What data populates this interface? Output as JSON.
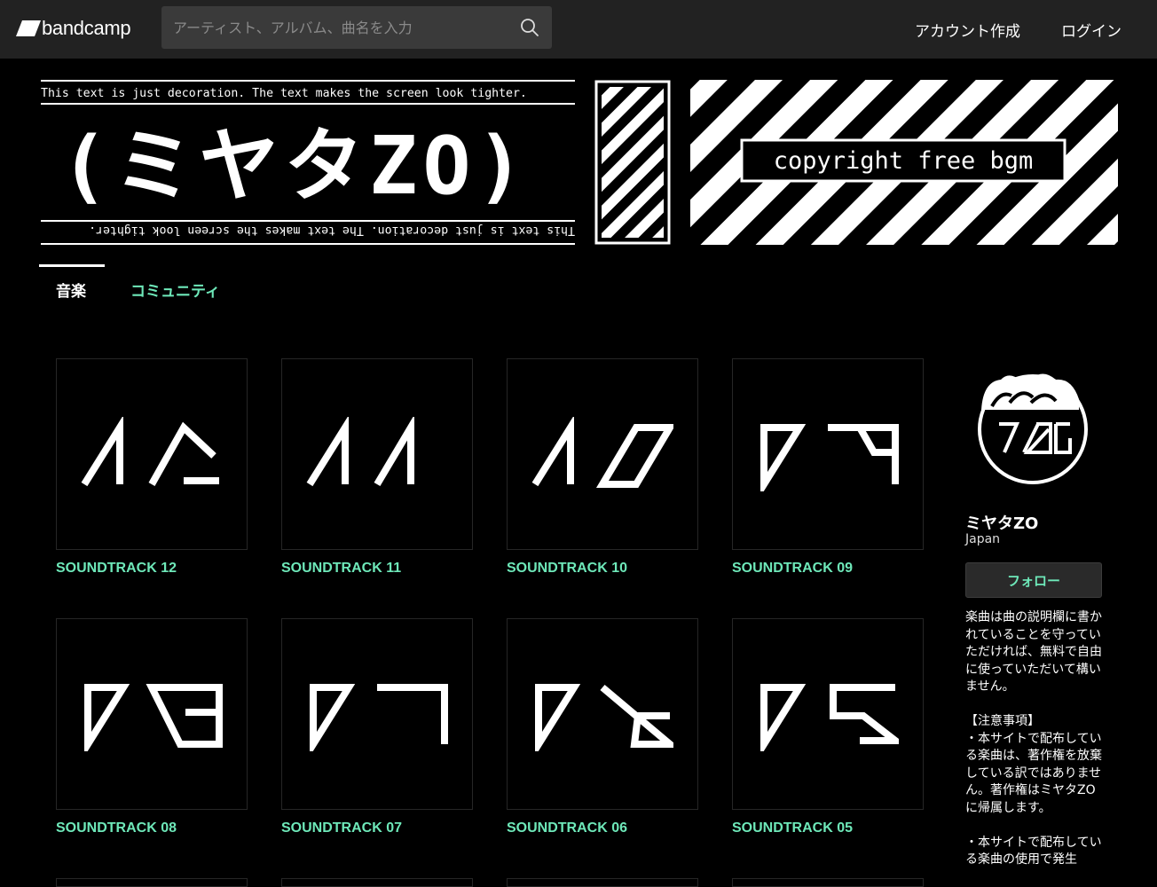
{
  "header": {
    "logo_text": "bandcamp",
    "search_placeholder": "アーティスト、アルバム、曲名を入力",
    "create_account": "アカウント作成",
    "login": "ログイン"
  },
  "banner": {
    "top_text": "This text is just decoration. The text makes the screen look tighter.",
    "bottom_text": "This text is just decoration. The text makes the screen look tighter.",
    "title": "(ミヤタZO)",
    "tagline": "copyright free bgm"
  },
  "tabs": [
    {
      "label": "音楽",
      "active": true
    },
    {
      "label": "コミュニティ",
      "active": false
    }
  ],
  "albums": [
    {
      "title": "SOUNDTRACK 12",
      "art": "12"
    },
    {
      "title": "SOUNDTRACK 11",
      "art": "11"
    },
    {
      "title": "SOUNDTRACK 10",
      "art": "10"
    },
    {
      "title": "SOUNDTRACK 09",
      "art": "09"
    },
    {
      "title": "SOUNDTRACK 08",
      "art": "08"
    },
    {
      "title": "SOUNDTRACK 07",
      "art": "07"
    },
    {
      "title": "SOUNDTRACK 06",
      "art": "06"
    },
    {
      "title": "SOUNDTRACK 05",
      "art": "05"
    }
  ],
  "artist": {
    "name": "ミヤタZO",
    "location": "Japan",
    "follow_label": "フォロー",
    "bio": "楽曲は曲の説明欄に書かれていることを守っていただければ、無料で自由に使っていただいて構いません。\n\n【注意事項】\n・本サイトで配布している楽曲は、著作権を放棄している訳ではありません。著作権はミヤタZOに帰属します。\n\n・本サイトで配布している楽曲の使用で発生"
  },
  "colors": {
    "accent": "#6ee8b9",
    "topbar": "#222222",
    "background": "#000000"
  }
}
